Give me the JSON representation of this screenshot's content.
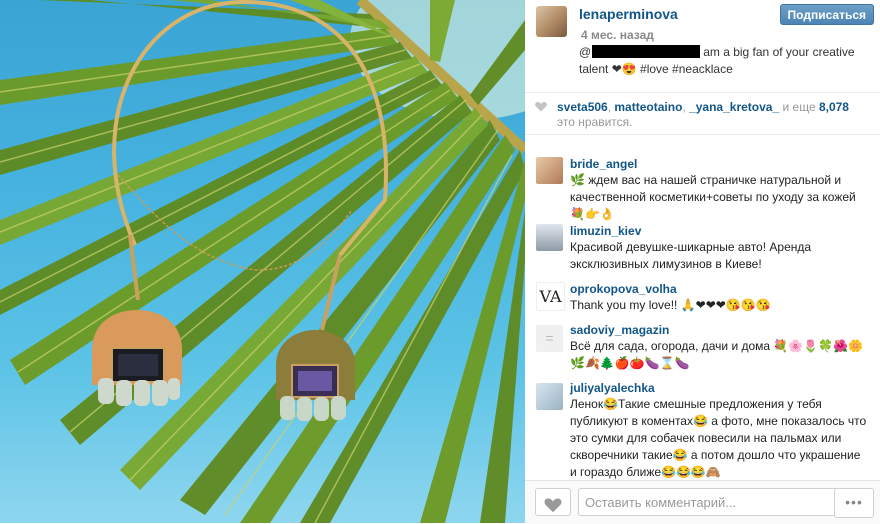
{
  "post": {
    "username": "lenaperminova",
    "time": "4 мес. назад",
    "follow_label": "Подписаться",
    "caption_prefix": "@",
    "caption_text": "am a big fan of your creative talent ❤😍 #love #neacklace"
  },
  "likes": {
    "users": [
      "sveta506",
      "matteotaino",
      "_yana_kretova_"
    ],
    "sep1": ", ",
    "sep2": ", ",
    "and_text": " и еще ",
    "count": "8,078",
    "suffix": " это нравится."
  },
  "comments": [
    {
      "user": "bride_angel",
      "text": "🌿 ждем вас на нашей страничке натуральной и качественной косметики+советы по уходу за кожей 💐👉👌"
    },
    {
      "user": "limuzin_kiev",
      "text": "Красивой девушке-шикарные авто! Аренда эксклюзивных лимузинов в Киеве!"
    },
    {
      "user": "oprokopova_volha",
      "text": "Thank you my love!! 🙏❤❤❤😘😘😘"
    },
    {
      "user": "sadoviy_magazin",
      "text": "Всё для сада, огорода, дачи и дома 💐🌸🌷🍀🌺🌼🌿🍂🌲🍎🍅🍆⌛🍆"
    },
    {
      "user": "juliyalyalechka",
      "text": "Ленок😂Такие смешные предложения у тебя публикуют в коментах😂 а фото, мне показалось что это сумки для собачек повесили на пальмах или скворечники такие😂 а потом дошло что украшение и гораздо ближе😂😂😂🙈"
    }
  ],
  "footer": {
    "comment_placeholder": "Оставить комментарий...",
    "more_label": "•••"
  },
  "colors": {
    "link": "#125688",
    "follow_button": "#4b84b4"
  }
}
